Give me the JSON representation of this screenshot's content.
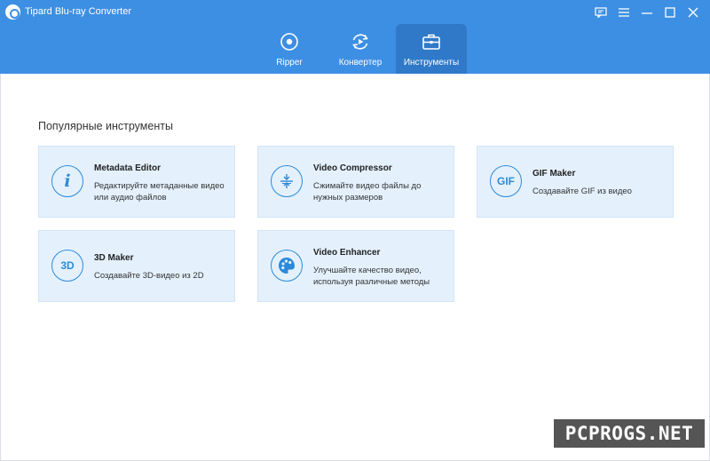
{
  "app": {
    "title": "Tipard Blu-ray Converter"
  },
  "window_controls": [
    {
      "name": "feedback-icon"
    },
    {
      "name": "menu-icon"
    },
    {
      "name": "minimize-icon"
    },
    {
      "name": "maximize-icon"
    },
    {
      "name": "close-icon"
    }
  ],
  "tabs": [
    {
      "label": "Ripper",
      "icon": "disc-icon",
      "active": false
    },
    {
      "label": "Конвертер",
      "icon": "convert-icon",
      "active": false
    },
    {
      "label": "Инструменты",
      "icon": "toolbox-icon",
      "active": true
    }
  ],
  "main": {
    "section_title": "Популярные инструменты",
    "tools": [
      {
        "title": "Metadata Editor",
        "desc": "Редактируйте метаданные видео или аудио файлов",
        "icon": "info-icon"
      },
      {
        "title": "Video Compressor",
        "desc": "Сжимайте видео файлы до нужных размеров",
        "icon": "compress-icon"
      },
      {
        "title": "GIF Maker",
        "desc": "Создавайте GIF из видео",
        "icon": "gif-icon",
        "icon_text": "GIF"
      },
      {
        "title": "3D Maker",
        "desc": "Создавайте 3D-видео из 2D",
        "icon": "3d-icon",
        "icon_text": "3D"
      },
      {
        "title": "Video Enhancer",
        "desc": "Улучшайте качество видео, используя различные методы",
        "icon": "palette-icon"
      }
    ]
  },
  "watermark": "PCPROGS.NET",
  "colors": {
    "header": "#3d8fe3",
    "active_tab": "#2f79c8",
    "card_bg": "#e4f1fd",
    "accent": "#2d8ad8"
  }
}
